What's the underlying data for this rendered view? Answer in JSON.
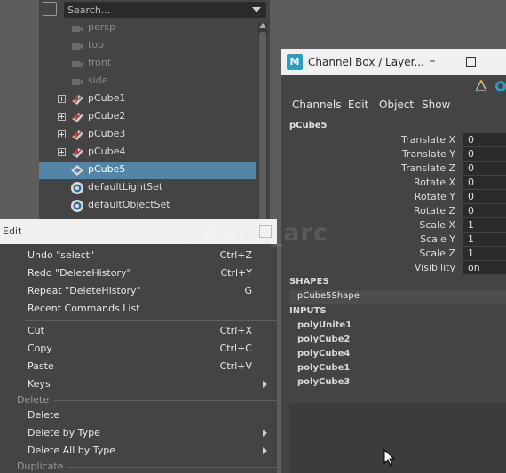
{
  "outliner": {
    "search_placeholder": "Search...",
    "items": [
      {
        "label": "persp",
        "dim": true,
        "icon": "camera-icon"
      },
      {
        "label": "top",
        "dim": true,
        "icon": "camera-icon"
      },
      {
        "label": "front",
        "dim": true,
        "icon": "camera-icon"
      },
      {
        "label": "side",
        "dim": true,
        "icon": "camera-icon"
      },
      {
        "label": "pCube1",
        "expandable": true,
        "icon": "mesh-icon"
      },
      {
        "label": "pCube2",
        "expandable": true,
        "icon": "mesh-icon"
      },
      {
        "label": "pCube3",
        "expandable": true,
        "icon": "mesh-icon"
      },
      {
        "label": "pCube4",
        "expandable": true,
        "icon": "mesh-icon"
      },
      {
        "label": "pCube5",
        "selected": true,
        "icon": "mesh-icon"
      },
      {
        "label": "defaultLightSet",
        "icon": "set-icon"
      },
      {
        "label": "defaultObjectSet",
        "icon": "set-icon"
      }
    ]
  },
  "channel_box": {
    "app_icon": "M",
    "title": "Channel Box / Layer...",
    "menus": [
      "Channels",
      "Edit",
      "Object",
      "Show"
    ],
    "node_name": "pCube5",
    "attributes": [
      {
        "name": "Translate X",
        "value": "0"
      },
      {
        "name": "Translate Y",
        "value": "0"
      },
      {
        "name": "Translate Z",
        "value": "0"
      },
      {
        "name": "Rotate X",
        "value": "0"
      },
      {
        "name": "Rotate Y",
        "value": "0"
      },
      {
        "name": "Rotate Z",
        "value": "0"
      },
      {
        "name": "Scale X",
        "value": "1"
      },
      {
        "name": "Scale Y",
        "value": "1"
      },
      {
        "name": "Scale Z",
        "value": "1"
      },
      {
        "name": "Visibility",
        "value": "on"
      }
    ],
    "shapes_header": "SHAPES",
    "shape_name": "pCube5Shape",
    "inputs_header": "INPUTS",
    "inputs": [
      "polyUnite1",
      "polyCube2",
      "polyCube4",
      "polyCube1",
      "polyCube3"
    ]
  },
  "watermark": "@dans_arc",
  "edit_menu": {
    "title": "Edit",
    "items1": [
      {
        "label": "Undo \"select\"",
        "shortcut": "Ctrl+Z"
      },
      {
        "label": "Redo \"DeleteHistory\"",
        "shortcut": "Ctrl+Y"
      },
      {
        "label": "Repeat \"DeleteHistory\"",
        "shortcut": "G"
      },
      {
        "label": "Recent Commands List",
        "shortcut": ""
      }
    ],
    "items2": [
      {
        "label": "Cut",
        "shortcut": "Ctrl+X"
      },
      {
        "label": "Copy",
        "shortcut": "Ctrl+C"
      },
      {
        "label": "Paste",
        "shortcut": "Ctrl+V"
      },
      {
        "label": "Keys",
        "shortcut": "",
        "submenu": true
      }
    ],
    "section_delete": "Delete",
    "items3": [
      {
        "label": "Delete",
        "shortcut": ""
      },
      {
        "label": "Delete by Type",
        "shortcut": "",
        "submenu": true
      },
      {
        "label": "Delete All by Type",
        "shortcut": "",
        "submenu": true
      }
    ],
    "section_duplicate": "Duplicate"
  }
}
